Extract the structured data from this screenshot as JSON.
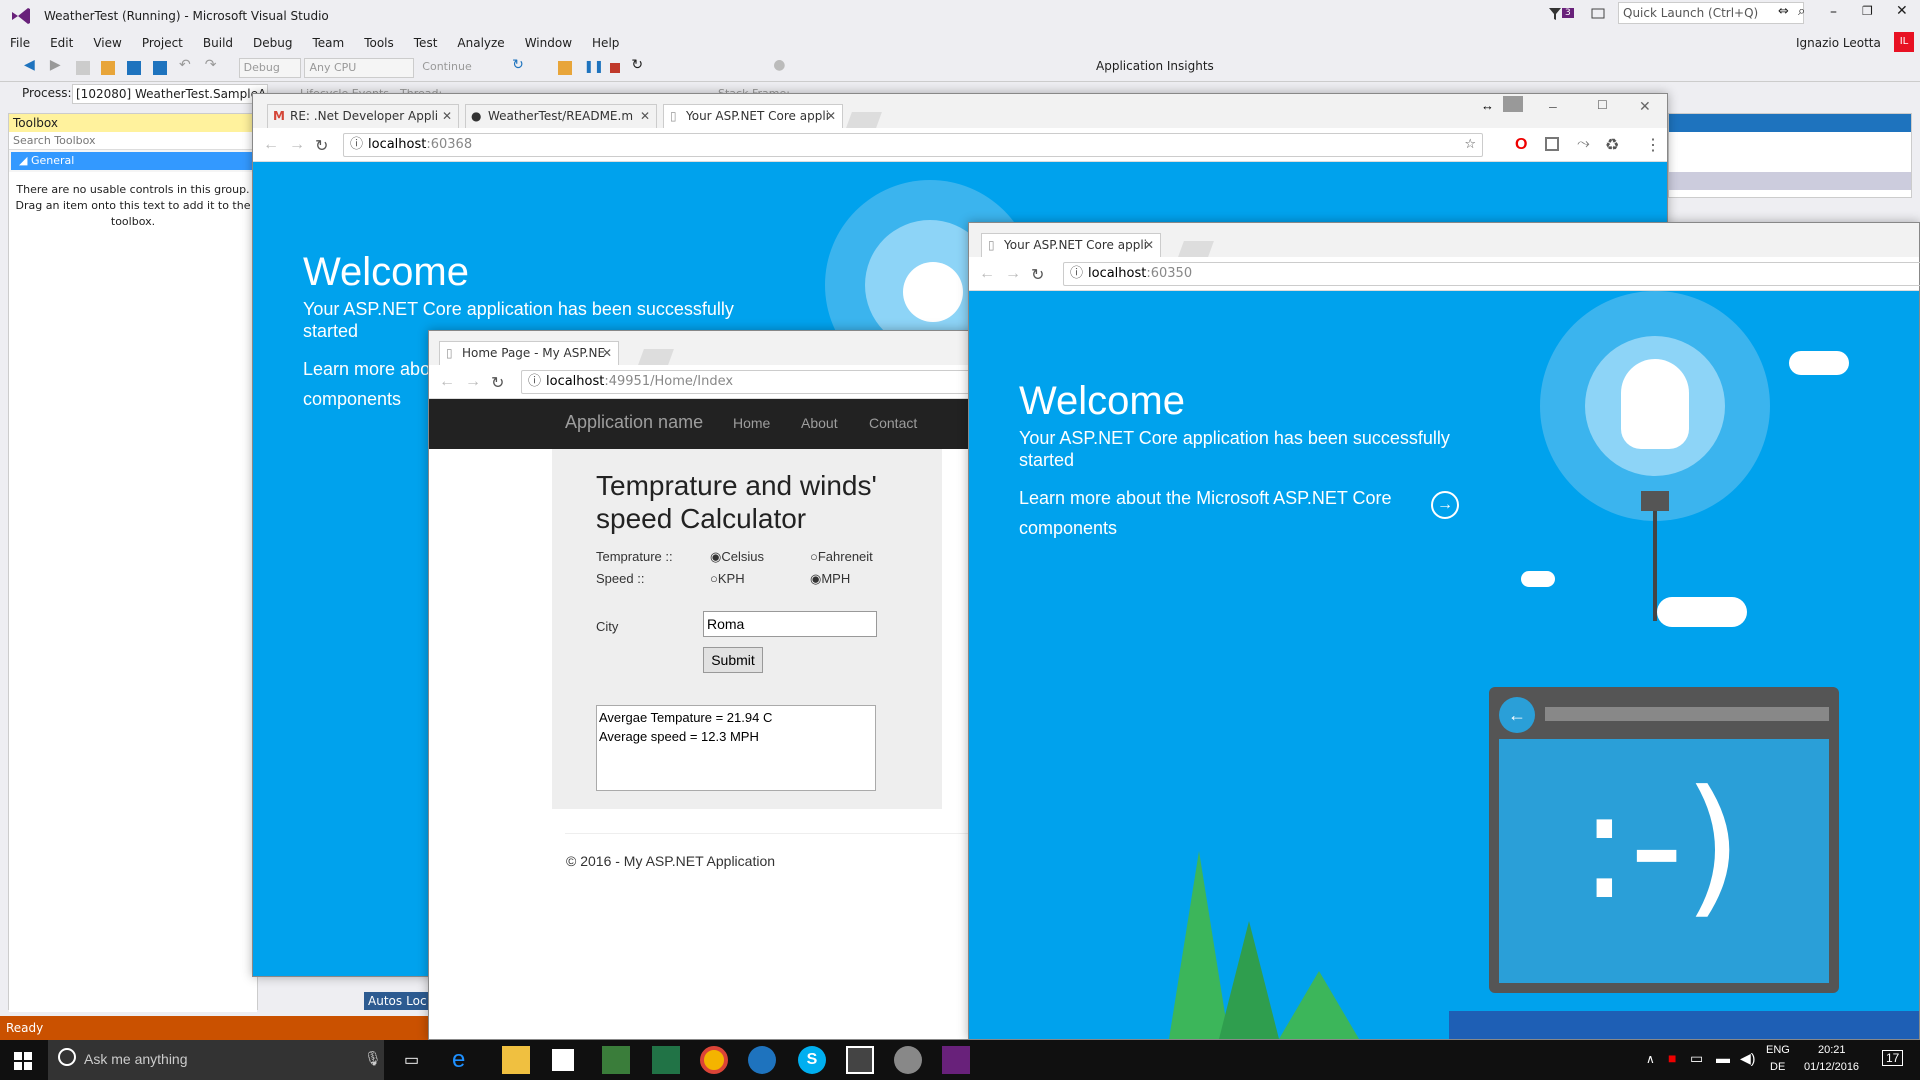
{
  "vs": {
    "title": "WeatherTest (Running) - Microsoft Visual Studio",
    "filter_count": "3",
    "quick_launch": "Quick Launch (Ctrl+Q)",
    "menu": [
      "File",
      "Edit",
      "View",
      "Project",
      "Build",
      "Debug",
      "Team",
      "Tools",
      "Test",
      "Analyze",
      "Window",
      "Help"
    ],
    "user": "Ignazio Leotta",
    "user_initials": "IL",
    "toolbar": {
      "config": "Debug",
      "platform": "Any CPU",
      "continue": "Continue",
      "insights": "Application Insights"
    },
    "process_label": "Process:",
    "process_value": "[102080] WeatherTest.SampleApi.E",
    "lifecycle": "Lifecycle Events",
    "thread": "Thread:",
    "stackframe": "Stack Frame:",
    "toolbox": {
      "title": "Toolbox",
      "search": "Search Toolbox",
      "group": "General",
      "message": "There are no usable controls in this group. Drag an item onto this text to add it to the toolbox."
    },
    "bottom_tabs": [
      "Autos",
      "Loc"
    ],
    "status": "Ready"
  },
  "taskbar": {
    "search": "Ask me anything",
    "lang1": "ENG",
    "lang2": "DE",
    "time": "20:21",
    "date": "01/12/2016",
    "notif": "17"
  },
  "browser1": {
    "tabs": [
      "RE: .Net Developer Appli",
      "WeatherTest/README.m",
      "Your ASP.NET Core appli"
    ],
    "url_host": "localhost",
    "url_port": ":60368",
    "welcome": "Welcome",
    "subtitle": "Your ASP.NET Core application has been successfully started",
    "learn": "Learn more abo",
    "learn2": "components"
  },
  "browser2": {
    "tab": "Home Page - My ASP.NE",
    "url_host": "localhost",
    "url_path": ":49951/Home/Index",
    "nav": {
      "brand": "Application name",
      "links": [
        "Home",
        "About",
        "Contact"
      ]
    },
    "form": {
      "heading": "Temprature and winds' speed Calculator",
      "temp_label": "Temprature ::",
      "temp_opts": [
        "Celsius",
        "Fahreneit"
      ],
      "speed_label": "Speed ::",
      "speed_opts": [
        "KPH",
        "MPH"
      ],
      "city_label": "City",
      "city_value": "Roma",
      "submit": "Submit",
      "result_line1": "Avergae Tempature = 21.94 C",
      "result_line2": "Average speed = 12.3 MPH"
    },
    "footer": "© 2016 - My ASP.NET Application"
  },
  "browser3": {
    "tab": "Your ASP.NET Core appli",
    "url_host": "localhost",
    "url_port": ":60350",
    "welcome": "Welcome",
    "subtitle": "Your ASP.NET Core application has been successfully started",
    "learn": "Learn more about the Microsoft ASP.NET Core components"
  },
  "colors": {
    "blue": "#00a2ed",
    "vs_purple": "#68217a",
    "status_orange": "#ca5100"
  }
}
